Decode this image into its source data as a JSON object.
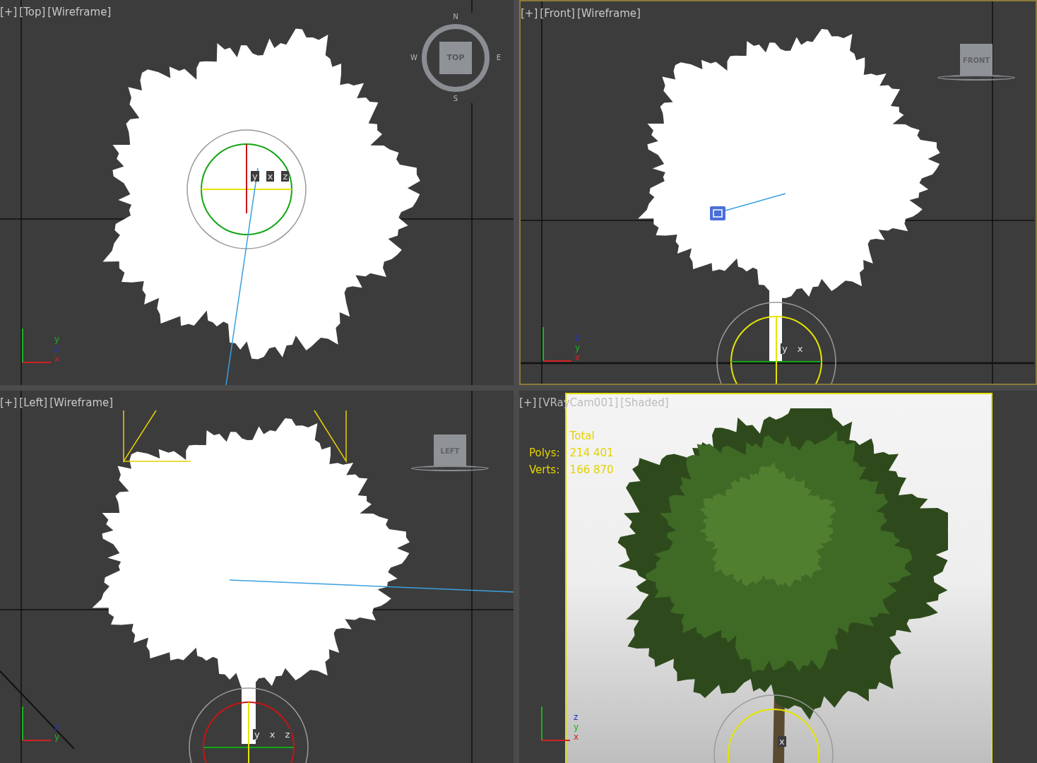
{
  "viewports": [
    {
      "kind": "top",
      "selected": false,
      "menus": [
        "[+]",
        "[Top]",
        "[Wireframe]"
      ],
      "navcube": {
        "label": "TOP",
        "compass": [
          "N",
          "E",
          "S",
          "W"
        ]
      },
      "axes": [
        "y",
        "z",
        "x"
      ],
      "gizmo": [
        "y",
        "x",
        "z"
      ]
    },
    {
      "kind": "front",
      "selected": true,
      "menus": [
        "[+]",
        "[Front]",
        "[Wireframe]"
      ],
      "navcube": {
        "label": "FRONT"
      },
      "axes": [
        "z",
        "y",
        "x"
      ],
      "gizmo": [
        "y",
        "x"
      ]
    },
    {
      "kind": "left",
      "selected": false,
      "menus": [
        "[+]",
        "[Left]",
        "[Wireframe]"
      ],
      "navcube": {
        "label": "LEFT"
      },
      "axes": [
        "z",
        "y"
      ],
      "gizmo": [
        "y",
        "x",
        "z"
      ]
    },
    {
      "kind": "camera",
      "selected": false,
      "menus": [
        "[+]",
        "[VRayCam001]",
        "[Shaded]"
      ],
      "stats": {
        "header": "Total",
        "rows": [
          {
            "label": "Polys:",
            "value": "214 401"
          },
          {
            "label": "Verts:",
            "value": "166 870"
          }
        ]
      },
      "axes": [
        "z",
        "y",
        "x"
      ],
      "gizmo": [
        "x"
      ]
    }
  ]
}
